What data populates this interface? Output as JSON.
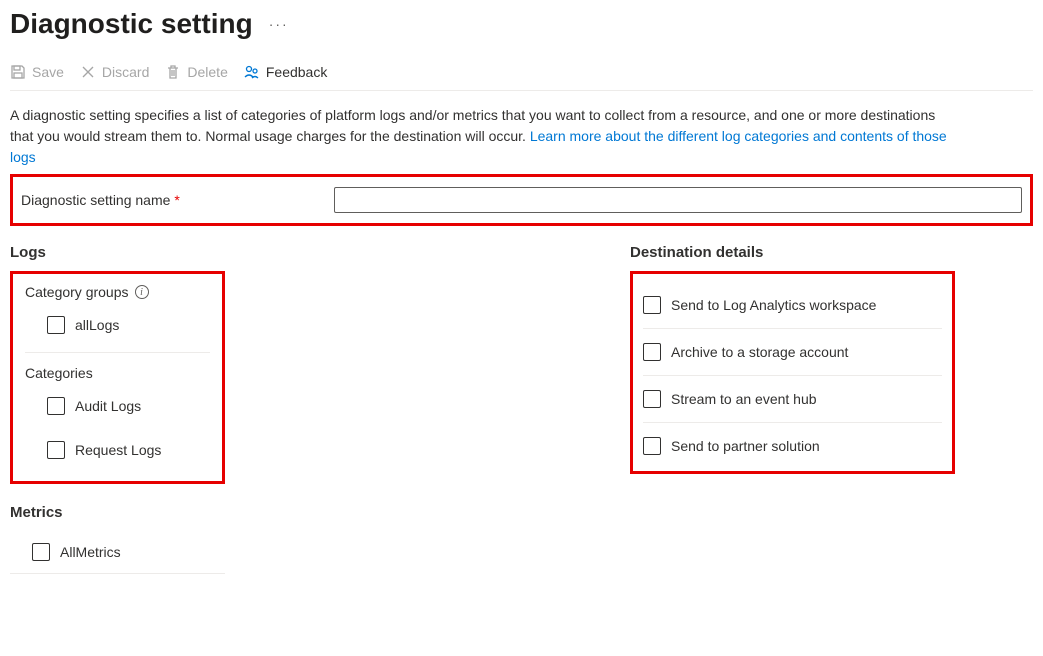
{
  "header": {
    "title": "Diagnostic setting"
  },
  "toolbar": {
    "save_label": "Save",
    "discard_label": "Discard",
    "delete_label": "Delete",
    "feedback_label": "Feedback"
  },
  "description": {
    "text_part1": "A diagnostic setting specifies a list of categories of platform logs and/or metrics that you want to collect from a resource, and one or more destinations that you would stream them to. Normal usage charges for the destination will occur. ",
    "link_text": "Learn more about the different log categories and contents of those logs"
  },
  "name": {
    "label": "Diagnostic setting name",
    "required_mark": "*",
    "value": ""
  },
  "logs": {
    "section_title": "Logs",
    "category_groups_label": "Category groups",
    "allLogs_label": "allLogs",
    "categories_label": "Categories",
    "audit_logs_label": "Audit Logs",
    "request_logs_label": "Request Logs"
  },
  "metrics": {
    "section_title": "Metrics",
    "all_metrics_label": "AllMetrics"
  },
  "destination": {
    "section_title": "Destination details",
    "log_analytics_label": "Send to Log Analytics workspace",
    "storage_label": "Archive to a storage account",
    "eventhub_label": "Stream to an event hub",
    "partner_label": "Send to partner solution"
  }
}
